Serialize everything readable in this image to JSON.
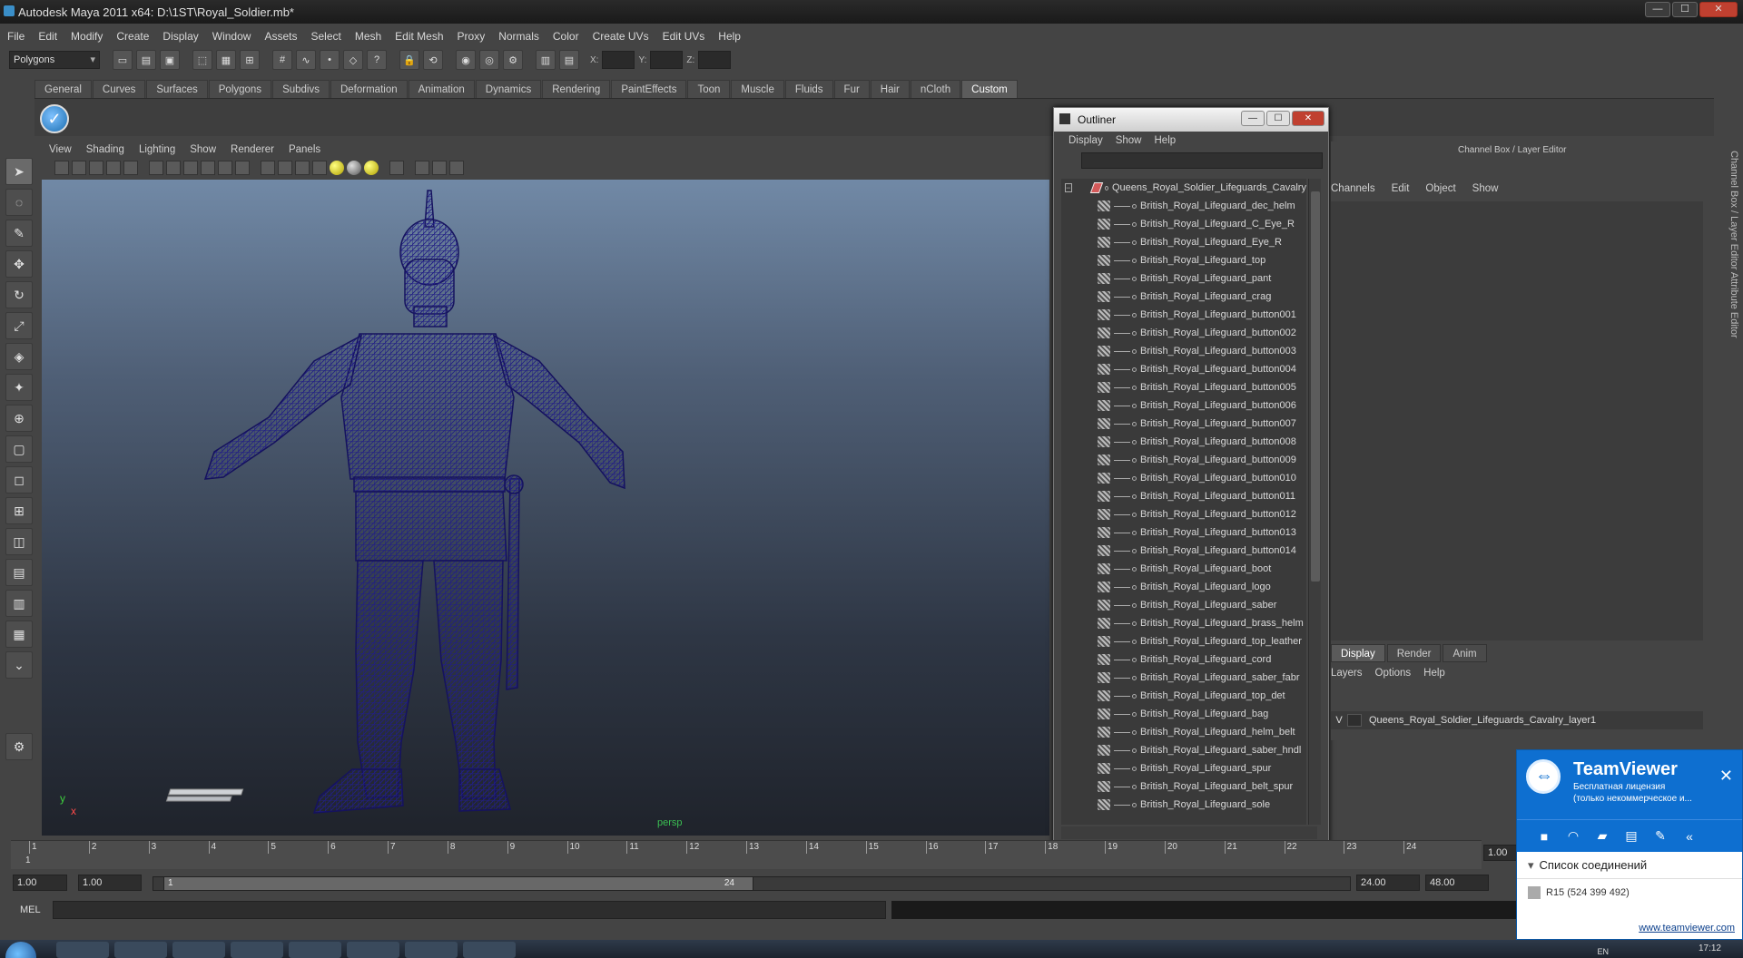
{
  "window": {
    "title": "Autodesk Maya 2011 x64: D:\\1ST\\Royal_Soldier.mb*",
    "min": "—",
    "max": "☐",
    "close": "✕"
  },
  "menubar": [
    "File",
    "Edit",
    "Modify",
    "Create",
    "Display",
    "Window",
    "Assets",
    "Select",
    "Mesh",
    "Edit Mesh",
    "Proxy",
    "Normals",
    "Color",
    "Create UVs",
    "Edit UVs",
    "Help"
  ],
  "statusline": {
    "mode": "Polygons",
    "x_label": "X:",
    "y_label": "Y:",
    "z_label": "Z:"
  },
  "shelf": {
    "tabs": [
      "General",
      "Curves",
      "Surfaces",
      "Polygons",
      "Subdivs",
      "Deformation",
      "Animation",
      "Dynamics",
      "Rendering",
      "PaintEffects",
      "Toon",
      "Muscle",
      "Fluids",
      "Fur",
      "Hair",
      "nCloth",
      "Custom"
    ],
    "active_tab": "Custom"
  },
  "viewport": {
    "menu": [
      "View",
      "Shading",
      "Lighting",
      "Show",
      "Renderer",
      "Panels"
    ],
    "camera": "persp",
    "axis_y": "y",
    "axis_x": "x",
    "mesh_color": "#1f1c7a"
  },
  "outliner": {
    "title": "Outliner",
    "menu": [
      "Display",
      "Show",
      "Help"
    ],
    "root": "Queens_Royal_Soldier_Lifeguards_Cavalry",
    "items": [
      "British_Royal_Lifeguard_dec_helm",
      "British_Royal_Lifeguard_C_Eye_R",
      "British_Royal_Lifeguard_Eye_R",
      "British_Royal_Lifeguard_top",
      "British_Royal_Lifeguard_pant",
      "British_Royal_Lifeguard_crag",
      "British_Royal_Lifeguard_button001",
      "British_Royal_Lifeguard_button002",
      "British_Royal_Lifeguard_button003",
      "British_Royal_Lifeguard_button004",
      "British_Royal_Lifeguard_button005",
      "British_Royal_Lifeguard_button006",
      "British_Royal_Lifeguard_button007",
      "British_Royal_Lifeguard_button008",
      "British_Royal_Lifeguard_button009",
      "British_Royal_Lifeguard_button010",
      "British_Royal_Lifeguard_button011",
      "British_Royal_Lifeguard_button012",
      "British_Royal_Lifeguard_button013",
      "British_Royal_Lifeguard_button014",
      "British_Royal_Lifeguard_boot",
      "British_Royal_Lifeguard_logo",
      "British_Royal_Lifeguard_saber",
      "British_Royal_Lifeguard_brass_helm",
      "British_Royal_Lifeguard_top_leather",
      "British_Royal_Lifeguard_cord",
      "British_Royal_Lifeguard_saber_fabr",
      "British_Royal_Lifeguard_top_det",
      "British_Royal_Lifeguard_bag",
      "British_Royal_Lifeguard_helm_belt",
      "British_Royal_Lifeguard_saber_hndl",
      "British_Royal_Lifeguard_spur",
      "British_Royal_Lifeguard_belt_spur",
      "British_Royal_Lifeguard_sole"
    ]
  },
  "channelbox": {
    "header": "Channel Box / Layer Editor",
    "menu": [
      "Channels",
      "Edit",
      "Object",
      "Show"
    ],
    "layer_tabs": [
      "Display",
      "Render",
      "Anim"
    ],
    "layer_menu": [
      "Layers",
      "Options",
      "Help"
    ],
    "layer_visible": "V",
    "layer_name": "Queens_Royal_Soldier_Lifeguards_Cavalry_layer1",
    "side_tabs": "Channel Box / Layer Editor    Attribute Editor"
  },
  "timeslider": {
    "ticks": [
      "1",
      "2",
      "3",
      "4",
      "5",
      "6",
      "7",
      "8",
      "9",
      "10",
      "11",
      "12",
      "13",
      "14",
      "15",
      "16",
      "17",
      "18",
      "19",
      "20",
      "21",
      "22",
      "23",
      "24"
    ],
    "current": "1",
    "current_time_field": "1.00"
  },
  "rangeslider": {
    "start": "1.00",
    "anim_start": "1.00",
    "range_start": "1",
    "range_end": "24",
    "end": "24.00",
    "anim_end": "48.00"
  },
  "cmdline": {
    "label": "MEL"
  },
  "teamviewer": {
    "title": "TeamViewer",
    "sub1": "Бесплатная лицензия",
    "sub2": "(только некоммерческое и...",
    "close": "✕",
    "list_title": "Список соединений",
    "item": "R15 (524 399 492)",
    "link": "www.teamviewer.com"
  },
  "taskbar": {
    "lang": "EN",
    "clock": "17:12"
  }
}
